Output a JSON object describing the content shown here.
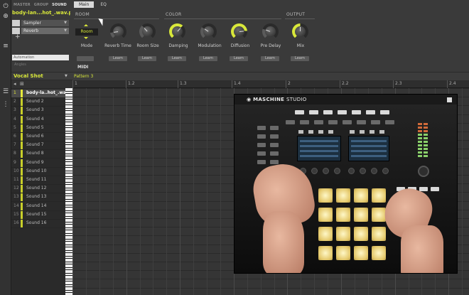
{
  "top_nav": {
    "master": "MASTER",
    "group": "GROUP",
    "sound": "SOUND"
  },
  "sound_title": "body-lan...hot_.wav.p",
  "plugin_slots": [
    {
      "label": "Sampler"
    },
    {
      "label": "Reverb"
    }
  ],
  "automation_placeholder": "Automation",
  "automation_hint": "Angles",
  "tabs": [
    {
      "label": "Main",
      "active": true
    },
    {
      "label": "EQ",
      "active": false
    }
  ],
  "sections": {
    "room": "ROOM",
    "color": "COLOR",
    "output": "OUTPUT"
  },
  "mode": {
    "value": "Room",
    "label": "Mode"
  },
  "params": [
    {
      "label": "Reverb Time",
      "value": 0.15,
      "active": false
    },
    {
      "label": "Room Size",
      "value": 0.35,
      "active": false
    },
    {
      "label": "Damping",
      "value": 0.65,
      "active": true
    },
    {
      "label": "Modulation",
      "value": 0.3,
      "active": false
    },
    {
      "label": "Diffusion",
      "value": 0.8,
      "active": true
    },
    {
      "label": "Pre Delay",
      "value": 0.25,
      "active": false
    },
    {
      "label": "Mix",
      "value": 0.5,
      "active": true
    }
  ],
  "learn_label": "Learn",
  "midi_label": "MIDI",
  "group": {
    "name": "Vocal Shot"
  },
  "pattern": {
    "name": "Pattern 3"
  },
  "ruler_labels": [
    "1",
    "1.2",
    "1.3",
    "1.4",
    "2",
    "2.2",
    "2.3",
    "2.4"
  ],
  "sounds": [
    {
      "num": "1",
      "name": "body-la..hot_.wav",
      "selected": true
    },
    {
      "num": "2",
      "name": "Sound 2"
    },
    {
      "num": "3",
      "name": "Sound 3"
    },
    {
      "num": "4",
      "name": "Sound 4"
    },
    {
      "num": "5",
      "name": "Sound 5"
    },
    {
      "num": "6",
      "name": "Sound 6"
    },
    {
      "num": "7",
      "name": "Sound 7"
    },
    {
      "num": "8",
      "name": "Sound 8"
    },
    {
      "num": "9",
      "name": "Sound 9"
    },
    {
      "num": "10",
      "name": "Sound 10"
    },
    {
      "num": "11",
      "name": "Sound 11"
    },
    {
      "num": "12",
      "name": "Sound 12"
    },
    {
      "num": "13",
      "name": "Sound 13"
    },
    {
      "num": "14",
      "name": "Sound 14"
    },
    {
      "num": "15",
      "name": "Sound 15"
    },
    {
      "num": "16",
      "name": "Sound 16"
    }
  ],
  "video": {
    "brand": "MASCHINE",
    "model": "STUDIO"
  },
  "colors": {
    "accent": "#d9e83a",
    "knob_active": "#d9e83a",
    "knob_inactive": "#5a5a5a"
  }
}
